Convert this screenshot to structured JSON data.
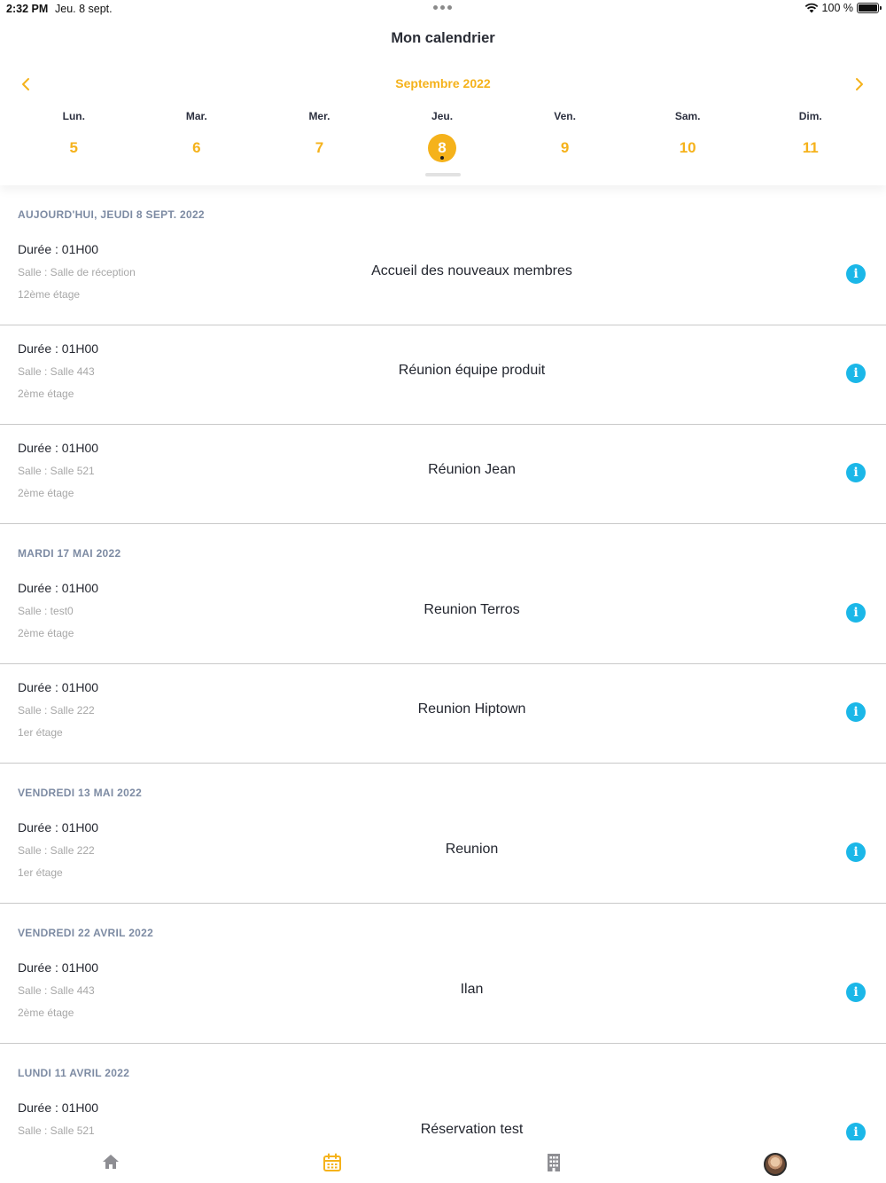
{
  "status_bar": {
    "time": "2:32 PM",
    "date": "Jeu. 8 sept.",
    "battery": "100 %"
  },
  "header": {
    "title": "Mon calendrier",
    "month": "Septembre 2022",
    "prev_icon": "chevron-left-icon",
    "next_icon": "chevron-right-icon",
    "accent_color": "#f5b21b",
    "days": [
      {
        "name": "Lun.",
        "num": "5"
      },
      {
        "name": "Mar.",
        "num": "6"
      },
      {
        "name": "Mer.",
        "num": "7"
      },
      {
        "name": "Jeu.",
        "num": "8",
        "selected": true
      },
      {
        "name": "Ven.",
        "num": "9"
      },
      {
        "name": "Sam.",
        "num": "10"
      },
      {
        "name": "Dim.",
        "num": "11"
      }
    ]
  },
  "sections": [
    {
      "header": "AUJOURD'HUI, JEUDI 8 SEPT. 2022",
      "events": [
        {
          "duration": "Durée : 01H00",
          "room": "Salle : Salle de réception",
          "floor": "12ème étage",
          "title": "Accueil des nouveaux membres"
        },
        {
          "duration": "Durée : 01H00",
          "room": "Salle : Salle 443",
          "floor": "2ème étage",
          "title": "Réunion équipe produit"
        },
        {
          "duration": "Durée : 01H00",
          "room": "Salle : Salle 521",
          "floor": "2ème étage",
          "title": "Réunion Jean"
        }
      ]
    },
    {
      "header": "MARDI 17 MAI 2022",
      "events": [
        {
          "duration": "Durée : 01H00",
          "room": "Salle : test0",
          "floor": "2ème étage",
          "title": "Reunion Terros"
        },
        {
          "duration": "Durée : 01H00",
          "room": "Salle : Salle 222",
          "floor": "1er étage",
          "title": "Reunion Hiptown"
        }
      ]
    },
    {
      "header": "VENDREDI 13 MAI 2022",
      "events": [
        {
          "duration": "Durée : 01H00",
          "room": "Salle : Salle 222",
          "floor": "1er étage",
          "title": "Reunion"
        }
      ]
    },
    {
      "header": "VENDREDI 22 AVRIL 2022",
      "events": [
        {
          "duration": "Durée : 01H00",
          "room": "Salle : Salle 443",
          "floor": "2ème étage",
          "title": "Ilan"
        }
      ]
    },
    {
      "header": "LUNDI 11 AVRIL 2022",
      "events": [
        {
          "duration": "Durée : 01H00",
          "room": "Salle : Salle 521",
          "floor": "",
          "title": "Réservation test"
        }
      ]
    }
  ],
  "info_icon": "info-icon",
  "info_color": "#1bb7e8",
  "tabbar": {
    "tabs": [
      {
        "name": "home",
        "icon": "home-icon",
        "active": false
      },
      {
        "name": "calendar",
        "icon": "calendar-icon",
        "active": true
      },
      {
        "name": "buildings",
        "icon": "building-icon",
        "active": false
      },
      {
        "name": "profile",
        "icon": "avatar",
        "active": false
      }
    ]
  }
}
